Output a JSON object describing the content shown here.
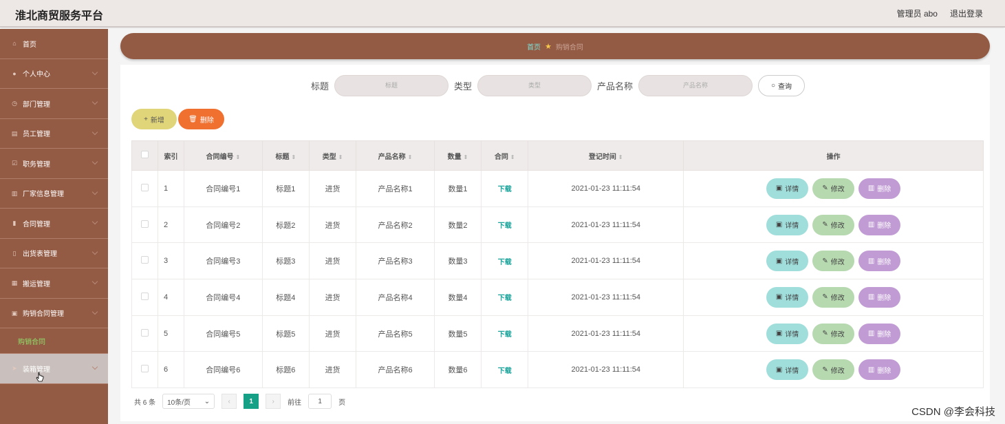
{
  "header": {
    "app_title": "淮北商贸服务平台",
    "user": "管理员 abo",
    "logout": "退出登录"
  },
  "sidebar": {
    "items": [
      {
        "label": "首页",
        "icon": "home-icon",
        "expandable": false
      },
      {
        "label": "个人中心",
        "icon": "user-icon",
        "expandable": true
      },
      {
        "label": "部门管理",
        "icon": "clock-icon",
        "expandable": true
      },
      {
        "label": "员工管理",
        "icon": "briefcase-icon",
        "expandable": true
      },
      {
        "label": "职务管理",
        "icon": "checkbox-icon",
        "expandable": true
      },
      {
        "label": "厂家信息管理",
        "icon": "trash-icon",
        "expandable": true
      },
      {
        "label": "合同管理",
        "icon": "bar-chart-icon",
        "expandable": true
      },
      {
        "label": "出货表管理",
        "icon": "chart-icon",
        "expandable": true
      },
      {
        "label": "搬运管理",
        "icon": "grid-icon",
        "expandable": true
      },
      {
        "label": "购销合同管理",
        "icon": "box-icon",
        "expandable": true
      }
    ],
    "sub_item": "购销合同",
    "last_item": {
      "label": "装箱管理",
      "icon": "send-icon"
    }
  },
  "breadcrumb": {
    "home": "首页",
    "current": "购销合同"
  },
  "search": {
    "fields": [
      {
        "label": "标题",
        "placeholder": "标题"
      },
      {
        "label": "类型",
        "placeholder": "类型"
      },
      {
        "label": "产品名称",
        "placeholder": "产品名称"
      }
    ],
    "button": "查询"
  },
  "actions": {
    "add": "新增",
    "delete": "删除"
  },
  "table": {
    "columns": [
      "索引",
      "合同编号",
      "标题",
      "类型",
      "产品名称",
      "数量",
      "合同",
      "登记时间",
      "操作"
    ],
    "rows": [
      {
        "idx": "1",
        "code": "合同编号1",
        "title": "标题1",
        "type": "进货",
        "product": "产品名称1",
        "qty": "数量1",
        "contract": "下载",
        "time": "2021-01-23 11:11:54"
      },
      {
        "idx": "2",
        "code": "合同编号2",
        "title": "标题2",
        "type": "进货",
        "product": "产品名称2",
        "qty": "数量2",
        "contract": "下载",
        "time": "2021-01-23 11:11:54"
      },
      {
        "idx": "3",
        "code": "合同编号3",
        "title": "标题3",
        "type": "进货",
        "product": "产品名称3",
        "qty": "数量3",
        "contract": "下载",
        "time": "2021-01-23 11:11:54"
      },
      {
        "idx": "4",
        "code": "合同编号4",
        "title": "标题4",
        "type": "进货",
        "product": "产品名称4",
        "qty": "数量4",
        "contract": "下载",
        "time": "2021-01-23 11:11:54"
      },
      {
        "idx": "5",
        "code": "合同编号5",
        "title": "标题5",
        "type": "进货",
        "product": "产品名称5",
        "qty": "数量5",
        "contract": "下载",
        "time": "2021-01-23 11:11:54"
      },
      {
        "idx": "6",
        "code": "合同编号6",
        "title": "标题6",
        "type": "进货",
        "product": "产品名称6",
        "qty": "数量6",
        "contract": "下载",
        "time": "2021-01-23 11:11:54"
      }
    ],
    "ops": {
      "detail": "详情",
      "edit": "修改",
      "delete": "删除"
    }
  },
  "pager": {
    "total": "共 6 条",
    "page_size": "10条/页",
    "current": "1",
    "goto_prefix": "前往",
    "goto_value": "1",
    "goto_suffix": "页"
  },
  "watermark": "CSDN @李会科技",
  "colors": {
    "sidebar": "#935a44",
    "accent": "#16a085",
    "delete": "#f07030"
  }
}
